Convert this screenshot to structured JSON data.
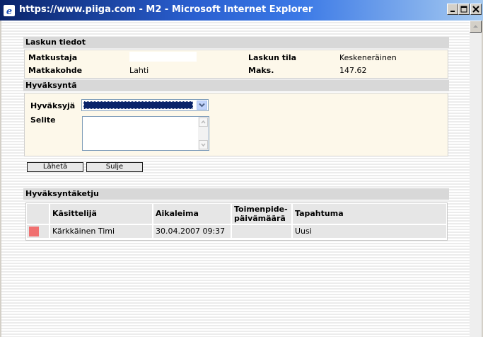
{
  "window": {
    "title": "https://www.piiga.com - M2 - Microsoft Internet Explorer"
  },
  "invoice": {
    "header": "Laskun tiedot",
    "traveller_label": "Matkustaja",
    "traveller_value": "",
    "destination_label": "Matkakohde",
    "destination_value": "Lahti",
    "status_label": "Laskun tila",
    "status_value": "Keskeneräinen",
    "max_label": "Maks.",
    "max_value": "147.62"
  },
  "approval": {
    "header": "Hyväksyntä",
    "approver_label": "Hyväksyjä",
    "approver_selected": "",
    "note_label": "Selite",
    "note_value": ""
  },
  "buttons": {
    "send": "Lähetä",
    "close": "Sulje"
  },
  "chain": {
    "header": "Hyväksyntäketju",
    "columns": [
      "Käsittelijä",
      "Aikaleima",
      "Toimenpide-päivämäärä",
      "Tapahtuma"
    ],
    "rows": [
      {
        "handler": "Kärkkäinen Timi",
        "timestamp": "30.04.2007 09:37",
        "action_date": "",
        "event": "Uusi",
        "status_color": "#f07070"
      }
    ]
  },
  "colors": {
    "titlebar": "#0a246a",
    "panel_bg": "#fdf8ea",
    "section_header": "#d8d8d8",
    "status_marker": "#f07070"
  }
}
